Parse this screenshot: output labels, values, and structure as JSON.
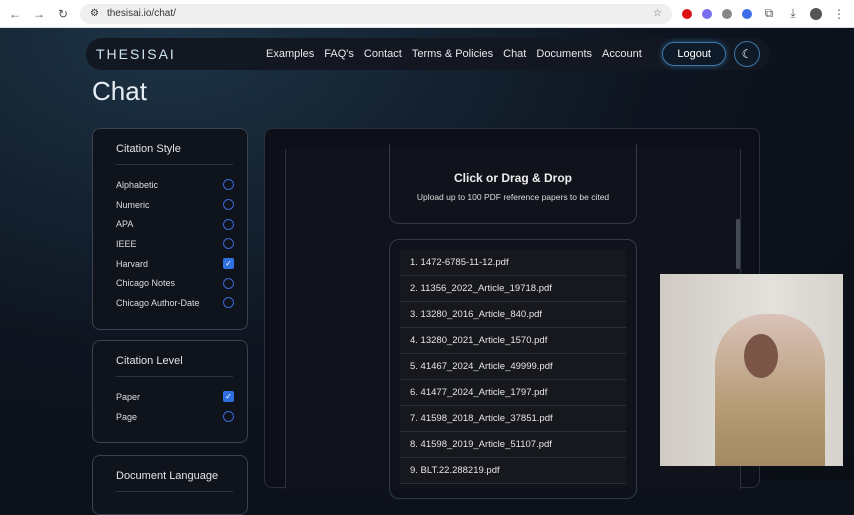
{
  "browser": {
    "url": "thesisai.io/chat/"
  },
  "nav": {
    "logo": "THESISAI",
    "links": [
      "Examples",
      "FAQ's",
      "Contact",
      "Terms & Policies",
      "Chat",
      "Documents",
      "Account"
    ],
    "logout": "Logout"
  },
  "page_title": "Chat",
  "citation_style": {
    "title": "Citation Style",
    "options": [
      {
        "label": "Alphabetic",
        "checked": false
      },
      {
        "label": "Numeric",
        "checked": false
      },
      {
        "label": "APA",
        "checked": false
      },
      {
        "label": "IEEE",
        "checked": false
      },
      {
        "label": "Harvard",
        "checked": true
      },
      {
        "label": "Chicago Notes",
        "checked": false
      },
      {
        "label": "Chicago Author-Date",
        "checked": false
      }
    ]
  },
  "citation_level": {
    "title": "Citation Level",
    "options": [
      {
        "label": "Paper",
        "checked": true
      },
      {
        "label": "Page",
        "checked": false
      }
    ]
  },
  "document_language": {
    "title": "Document Language"
  },
  "upload": {
    "title": "Click or Drag & Drop",
    "subtitle": "Upload up to 100 PDF reference papers to be cited"
  },
  "files": [
    "1. 1472-6785-11-12.pdf",
    "2. 11356_2022_Article_19718.pdf",
    "3. 13280_2016_Article_840.pdf",
    "4. 13280_2021_Article_1570.pdf",
    "5. 41467_2024_Article_49999.pdf",
    "6. 41477_2024_Article_1797.pdf",
    "7. 41598_2018_Article_37851.pdf",
    "8. 41598_2019_Article_51107.pdf",
    "9. BLT.22.288219.pdf"
  ]
}
